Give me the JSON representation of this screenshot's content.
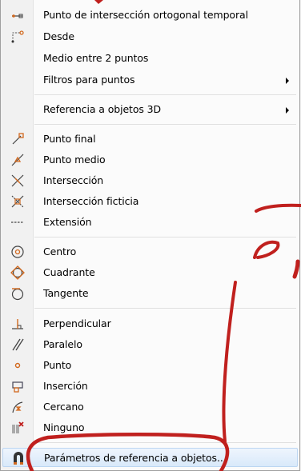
{
  "menu": {
    "items": [
      {
        "label": "Punto de intersección ortogonal temporal",
        "icon": "ortho-intersection-icon"
      },
      {
        "label": "Desde",
        "icon": "from-point-icon"
      },
      {
        "label": "Medio entre 2 puntos",
        "icon": ""
      },
      {
        "label": "Filtros para puntos",
        "icon": "",
        "submenu": true
      },
      {
        "label": "Referencia a objetos 3D",
        "icon": "",
        "submenu": true
      },
      {
        "label": "Punto final",
        "icon": "endpoint-icon"
      },
      {
        "label": "Punto medio",
        "icon": "midpoint-icon"
      },
      {
        "label": "Intersección",
        "icon": "intersection-icon"
      },
      {
        "label": "Intersección ficticia",
        "icon": "apparent-intersection-icon"
      },
      {
        "label": "Extensión",
        "icon": "extension-icon"
      },
      {
        "label": "Centro",
        "icon": "center-icon"
      },
      {
        "label": "Cuadrante",
        "icon": "quadrant-icon"
      },
      {
        "label": "Tangente",
        "icon": "tangent-icon"
      },
      {
        "label": "Perpendicular",
        "icon": "perpendicular-icon"
      },
      {
        "label": "Paralelo",
        "icon": "parallel-icon"
      },
      {
        "label": "Punto",
        "icon": "node-icon"
      },
      {
        "label": "Inserción",
        "icon": "insertion-icon"
      },
      {
        "label": "Cercano",
        "icon": "nearest-icon"
      },
      {
        "label": "Ninguno",
        "icon": "none-icon"
      },
      {
        "label": "Parámetros de referencia a objetos...",
        "icon": "osnap-settings-icon",
        "highlighted": true
      }
    ]
  },
  "colors": {
    "annotation": "#c0201e",
    "highlight": "#d9e9fa",
    "snap_icon": "#d2691e"
  }
}
